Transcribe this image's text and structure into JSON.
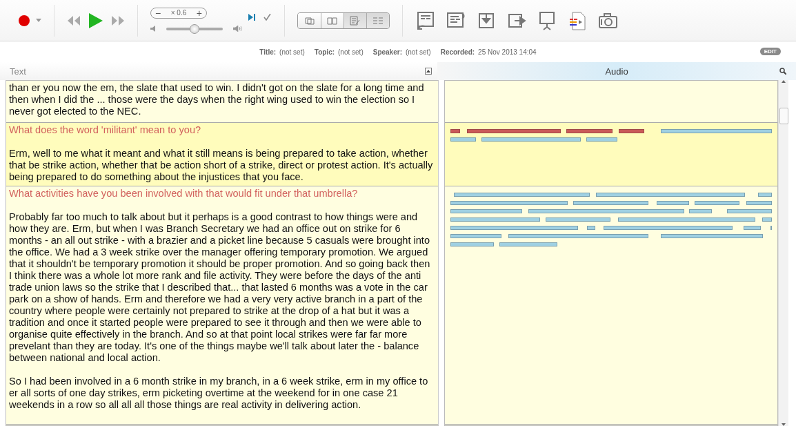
{
  "toolbar": {
    "speed": {
      "minus": "−",
      "value": "× 0.6",
      "plus": "+"
    },
    "volume": {
      "level": 0.5
    },
    "view_buttons": [
      {
        "selected": false
      },
      {
        "selected": false
      },
      {
        "selected": true
      },
      {
        "selected": true
      }
    ]
  },
  "metadata": [
    {
      "label": "Title:",
      "value": "(not set)"
    },
    {
      "label": "Topic:",
      "value": "(not set)"
    },
    {
      "label": "Speaker:",
      "value": "(not set)"
    },
    {
      "label": "Recorded:",
      "value": "25 Nov 2013 14:04"
    }
  ],
  "edit_button": "EDIT",
  "panes": {
    "text": "Text",
    "audio": "Audio"
  },
  "segments": [
    {
      "selected": false,
      "answer": [
        "than er you now the em, the slate that used to win. I didn't got on the slate for a long time and then when I did the ... those were the days when the right wing used to win the election so I never got elected to the NEC."
      ]
    },
    {
      "selected": true,
      "question": "What does the word 'militant' mean to you?",
      "answer": [
        "Erm, well to me what it meant and what it still means is being prepared to take action, whether that be strike action, whether that be action short of a strike, direct or protest action.  It's actually being prepared to do something about the injustices that you face."
      ]
    },
    {
      "selected": false,
      "question": "What activities have you been involved with that would fit under that umbrella?",
      "answer": [
        "Probably far too much to talk about but it perhaps is a good contrast to how things were and how they are.  Erm, but when I was Branch Secretary we had an office out on strike for 6 months - an all out strike - with a brazier and a picket line because 5 casuals were brought into the office.  We had a 3 week strike over the manager offering temporary promotion.  We argued that it shouldn't be temporary promotion it should be proper promotion.  And so going back then I think there was a whole lot more rank and file activity.  They were before the days of the anti trade union laws so the strike that I described that... that lasted 6 months was a vote in the car park on a show of hands.  Erm and therefore we had a very very active branch in a part of the country where people were certainly not prepared to strike at the drop of a hat but it was a tradition and once it started people were prepared to see it through and then we were able to organise quite effectively in the branch.  And so at that point local strikes were far far more prevelant than they are today. It's one of the things maybe we'll talk about later the - balance between national and local action.",
        "So I had been involved in a 6 month strike in my branch, in a 6 week strike, erm in my office to er all sorts of one day strikes, erm picketing overtime at the weekend for in one case 21 weekends in a  row so all all all those things are real activity in delivering action."
      ]
    }
  ]
}
